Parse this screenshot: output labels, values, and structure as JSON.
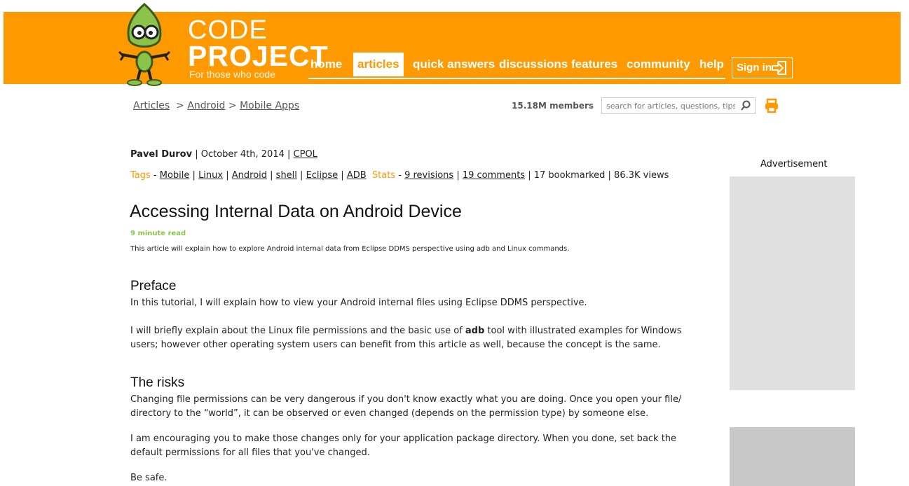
{
  "header": {
    "logo": {
      "code": "CODE",
      "project": "PROJECT",
      "reg": "®",
      "tagline": "For those who code"
    },
    "nav": [
      "home",
      "articles",
      "quick answers",
      "discussions",
      "features",
      "community",
      "help"
    ],
    "active_nav": "articles",
    "sign_in": "Sign in",
    "accent_color": "#ff9900"
  },
  "breadcrumb": {
    "items": [
      "Articles",
      "Android",
      "Mobile Apps"
    ],
    "sep": ">"
  },
  "members": "15.18M members",
  "search": {
    "placeholder": "search for articles, questions, tips"
  },
  "article": {
    "author": "Pavel Durov",
    "date": "October 4th, 2014",
    "license": "CPOL",
    "tags_label": "Tags",
    "tags": [
      "Mobile",
      "Linux",
      "Android",
      "shell",
      "Eclipse",
      "ADB"
    ],
    "stats_label": "Stats",
    "revisions": "9 revisions",
    "comments": "19 comments",
    "bookmarked": "17 bookmarked",
    "views": "86.3K views",
    "title": "Accessing Internal Data on Android Device",
    "read_time": "9 minute read",
    "summary": "This article will explain how to explore Android internal data from Eclipse DDMS perspective using adb and Linux commands.",
    "sections": {
      "preface": {
        "heading": "Preface",
        "p1": "In this tutorial, I will explain how to view your Android internal files using Eclipse DDMS perspective.",
        "p2_a": "I will briefly explain about the Linux file permissions and the basic use of ",
        "p2_b": "adb",
        "p2_c": " tool with illustrated examples for Windows users; however other operating system users can benefit from this article as well, because the concept is the same."
      },
      "risks": {
        "heading": "The risks",
        "p1": "Changing file permissions can be very dangerous if you don't know exactly what you are doing. Once you open your file/ directory to the “world”, it can be observed or even changed (depends on the permission type) by someone else.",
        "p2": "I am encouraging you to make those changes only for your application package directory. When you done, set back the default permissions for all files that you've changed.",
        "p3": "Be safe."
      }
    }
  },
  "sidebar": {
    "ad_label": "Advertisement"
  }
}
